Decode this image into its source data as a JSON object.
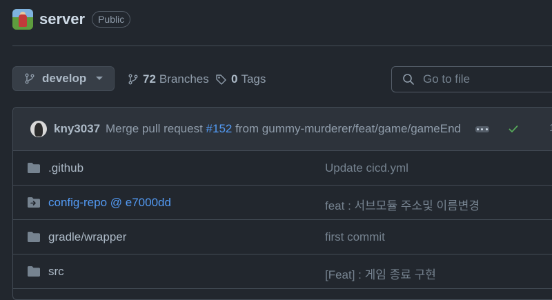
{
  "repo": {
    "name": "server",
    "visibility": "Public"
  },
  "branch_selector": {
    "current": "develop"
  },
  "branches": {
    "count": "72",
    "label": "Branches"
  },
  "tags": {
    "count": "0",
    "label": "Tags"
  },
  "search": {
    "placeholder": "Go to file"
  },
  "latest_commit": {
    "author": "kny3037",
    "message_prefix": "Merge pull request ",
    "pr_number": "#152",
    "message_suffix": " from gummy-murderer/feat/game/gameEnd",
    "status": "success",
    "extra": "1"
  },
  "files": [
    {
      "name": ".github",
      "type": "folder",
      "message": "Update cicd.yml"
    },
    {
      "name": "config-repo @ e7000dd",
      "type": "submodule",
      "message": "feat : 서브모듈 주소및 이름변경"
    },
    {
      "name": "gradle/wrapper",
      "type": "folder",
      "message": "first commit"
    },
    {
      "name": "src",
      "type": "folder",
      "message": "[Feat] : 게임 종료 구현"
    }
  ],
  "colors": {
    "background": "#22272e",
    "link": "#539bf5",
    "success": "#57ab5a"
  }
}
